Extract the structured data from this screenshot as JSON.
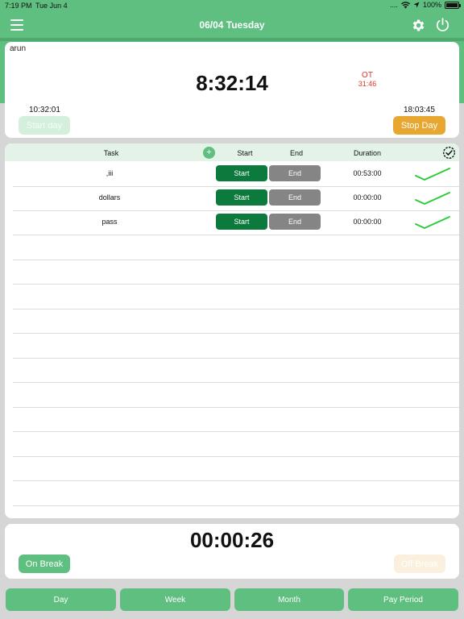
{
  "status_bar": {
    "time": "7:19 PM",
    "date": "Tue Jun 4",
    "signal": "....",
    "battery": "100%"
  },
  "header": {
    "title": "06/04 Tuesday"
  },
  "day": {
    "user": "arun",
    "clock": "8:32:14",
    "ot_label": "OT",
    "ot_value": "31:46",
    "start_time": "10:32:01",
    "stop_time": "18:03:45",
    "start_label": "Start day",
    "stop_label": "Stop Day"
  },
  "tasks": {
    "columns": {
      "task": "Task",
      "add": "+",
      "start": "Start",
      "end": "End",
      "duration": "Duration"
    },
    "rows": [
      {
        "name": ",iii",
        "start_label": "Start",
        "end_label": "End",
        "duration": "00:53:00"
      },
      {
        "name": "dollars",
        "start_label": "Start",
        "end_label": "End",
        "duration": "00:00:00"
      },
      {
        "name": "pass",
        "start_label": "Start",
        "end_label": "End",
        "duration": "00:00:00"
      }
    ]
  },
  "break": {
    "clock": "00:00:26",
    "on_label": "On Break",
    "off_label": "Off Break"
  },
  "tabs": {
    "day": "Day",
    "week": "Week",
    "month": "Month",
    "pay_period": "Pay Period"
  },
  "colors": {
    "primary_green": "#5fbf81",
    "dark_green": "#0b7a3c",
    "orange": "#e8a731",
    "ot_red": "#e0342b"
  }
}
